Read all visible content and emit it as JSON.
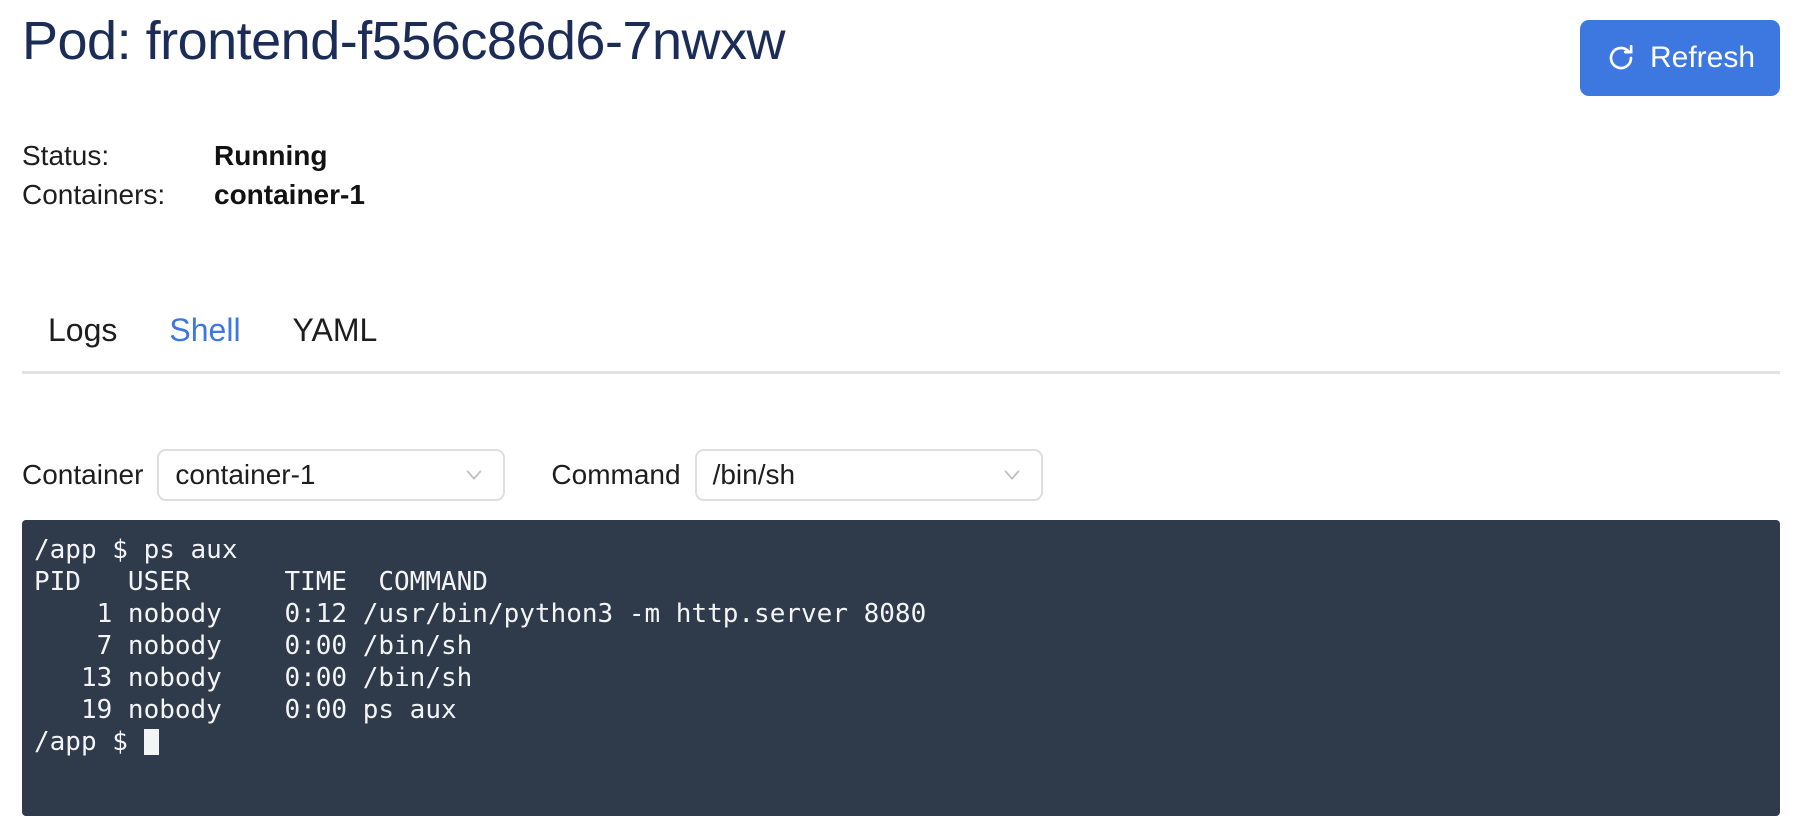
{
  "header": {
    "title": "Pod: frontend-f556c86d6-7nwxw",
    "refresh_label": "Refresh",
    "refresh_icon": "refresh-icon",
    "accent_color": "#3c78e0",
    "title_color": "#1b2c57"
  },
  "meta": {
    "rows": [
      {
        "label": "Status:",
        "value": "Running"
      },
      {
        "label": "Containers:",
        "value": "container-1"
      }
    ]
  },
  "tabs": {
    "items": [
      {
        "label": "Logs",
        "active": false
      },
      {
        "label": "Shell",
        "active": true
      },
      {
        "label": "YAML",
        "active": false
      }
    ]
  },
  "controls": {
    "container": {
      "label": "Container",
      "value": "container-1",
      "options": [
        "container-1"
      ],
      "chevron_icon": "chevron-down-icon"
    },
    "command": {
      "label": "Command",
      "value": "/bin/sh",
      "options": [
        "/bin/sh"
      ],
      "chevron_icon": "chevron-down-icon"
    }
  },
  "terminal": {
    "background_color": "#2f3b4a",
    "text_color": "#f2f4f6",
    "output": "/app $ ps aux\nPID   USER      TIME  COMMAND\n    1 nobody    0:12 /usr/bin/python3 -m http.server 8080\n    7 nobody    0:00 /bin/sh\n   13 nobody    0:00 /bin/sh\n   19 nobody    0:00 ps aux",
    "prompt": "/app $ "
  }
}
